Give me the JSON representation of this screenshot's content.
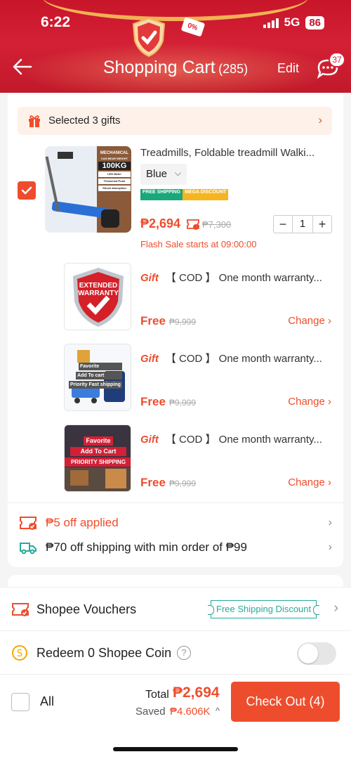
{
  "status_bar": {
    "time": "6:22",
    "network": "5G",
    "battery": "86"
  },
  "header": {
    "title": "Shopping Cart",
    "count": "(285)",
    "edit_label": "Edit",
    "chat_badge": "37",
    "promo_badge": "0%"
  },
  "gifts_bar": {
    "label": "Selected 3 gifts",
    "chevron": "›"
  },
  "product": {
    "name": "Treadmills, Foldable treadmill Walki...",
    "variant": "Blue",
    "variant_caret": "⌵",
    "badge_free_shipping": "FREE SHIPPING",
    "badge_mega_discount": "MEGA DISCOUNT",
    "price": "₱2,694",
    "old_price": "₱7,300",
    "quantity": "1",
    "qty_minus": "−",
    "qty_plus": "+",
    "flash_sale": "Flash Sale starts at 09:00:00",
    "image_text": {
      "mechanical": "MECHANICAL",
      "max_weight": "CAN BEAR WEIGHT",
      "weight": "100KG",
      "f1": "LED Meter",
      "f2": "Thickened Push",
      "f3": "Shock absorption"
    }
  },
  "gifts": [
    {
      "tag": "Gift",
      "text": "【 COD 】 One month warranty...",
      "free": "Free",
      "old_price": "₱9,999",
      "change": "Change ›",
      "image_text": [
        "EXTENDED",
        "WARRANTY"
      ]
    },
    {
      "tag": "Gift",
      "text": "【 COD 】 One month warranty...",
      "free": "Free",
      "old_price": "₱9,999",
      "change": "Change ›",
      "image_text": [
        "Favorite",
        "Add To cart",
        "Priority Fast shipping"
      ]
    },
    {
      "tag": "Gift",
      "text": "【 COD 】 One month warranty...",
      "free": "Free",
      "old_price": "₱9,999",
      "change": "Change ›",
      "image_text": [
        "Favorite",
        "Add To Cart",
        "PRIORITY SHIPPING"
      ]
    }
  ],
  "promos": [
    {
      "text": "₱5 off applied",
      "chevron": "›",
      "color": "#ee4d2d"
    },
    {
      "text": "₱70 off shipping with min order of ₱99",
      "chevron": "›",
      "color": "#222222"
    }
  ],
  "vouchers": {
    "label": "Shopee Vouchers",
    "badge": "Free Shipping Discount",
    "chevron": "›"
  },
  "coins": {
    "label": "Redeem 0 Shopee Coin",
    "help": "?",
    "toggle_on": false
  },
  "checkout": {
    "all_label": "All",
    "total_label": "Total",
    "total_value": "₱2,694",
    "saved_label": "Saved",
    "saved_value": "₱4.606K",
    "saved_caret": "^",
    "button_label": "Check Out (4)"
  },
  "colors": {
    "brand": "#ee4d2d",
    "header": "#d42035",
    "teal": "#26aa99"
  }
}
